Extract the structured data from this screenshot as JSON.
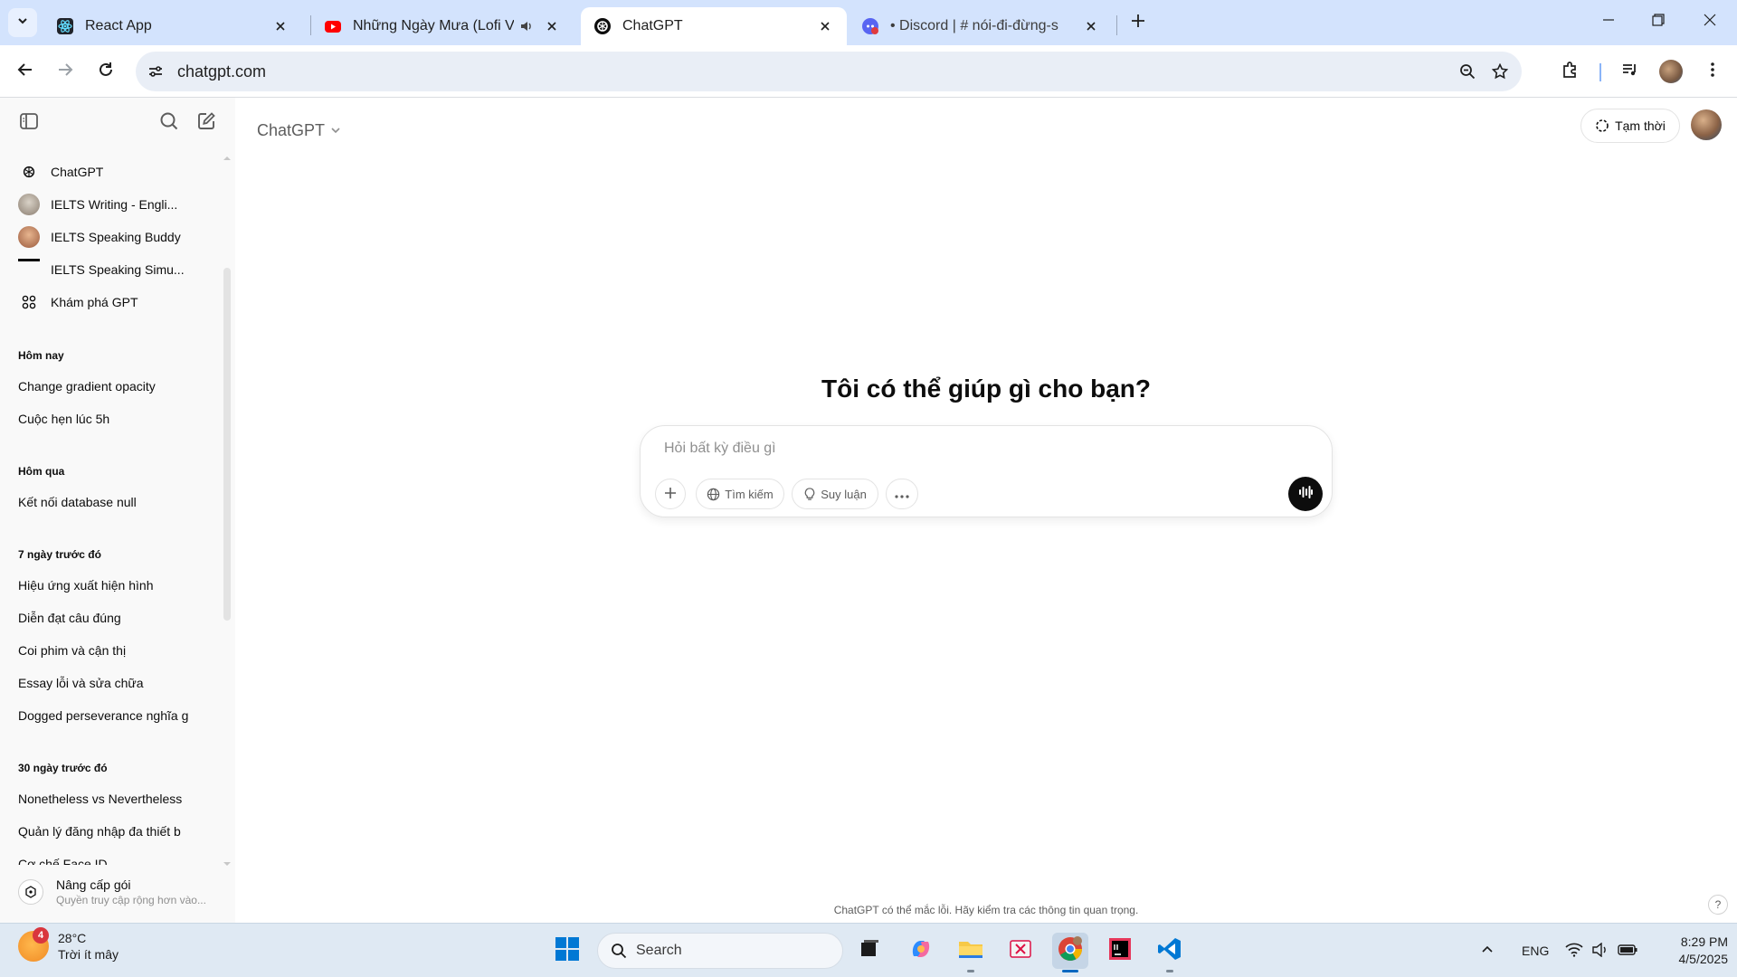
{
  "browser": {
    "tabs": [
      {
        "title": "React App",
        "icon": "react-icon",
        "active": false
      },
      {
        "title": "Những Ngày Mưa (Lofi Ver.)",
        "icon": "youtube-icon",
        "active": false,
        "audio": true
      },
      {
        "title": "ChatGPT",
        "icon": "openai-icon",
        "active": true
      },
      {
        "title": "• Discord | #​ nói-đi-đừng-s",
        "icon": "discord-icon",
        "active": false
      }
    ],
    "url": "chatgpt.com",
    "accent": "#d3e3fd"
  },
  "sidebar": {
    "gpts": [
      {
        "label": "ChatGPT",
        "icon": "openai-icon"
      },
      {
        "label": "IELTS Writing - Engli...",
        "icon": "gpt-avatar-icon"
      },
      {
        "label": "IELTS Speaking Buddy",
        "icon": "gpt-avatar-icon"
      },
      {
        "label": "IELTS Speaking Simu...",
        "icon": "gpt-avatar-icon"
      },
      {
        "label": "Khám phá GPT",
        "icon": "grid-icon"
      }
    ],
    "sections": [
      {
        "title": "Hôm nay",
        "chats": [
          "Change gradient opacity",
          "Cuộc hẹn lúc 5h"
        ]
      },
      {
        "title": "Hôm qua",
        "chats": [
          "Kết nối database null"
        ]
      },
      {
        "title": "7 ngày trước đó",
        "chats": [
          "Hiệu ứng xuất hiện hình",
          "Diễn đạt câu đúng",
          "Coi phim và cận thị",
          "Essay lỗi và sửa chữa",
          "Dogged perseverance nghĩa g"
        ]
      },
      {
        "title": "30 ngày trước đó",
        "chats": [
          "Nonetheless vs Nevertheless",
          "Quản lý đăng nhập đa thiết b",
          "Cơ chế Face ID"
        ]
      }
    ],
    "upgrade": {
      "title": "Nâng cấp gói",
      "subtitle": "Quyền truy cập rộng hơn vào..."
    }
  },
  "main": {
    "model": "ChatGPT",
    "temporary": "Tạm thời",
    "headline": "Tôi có thể giúp gì cho bạn?",
    "composer": {
      "placeholder": "Hỏi bất kỳ điều gì",
      "search": "Tìm kiếm",
      "reason": "Suy luận"
    },
    "disclaimer": "ChatGPT có thể mắc lỗi. Hãy kiểm tra các thông tin quan trọng.",
    "help": "?"
  },
  "taskbar": {
    "weather": {
      "temp": "28°C",
      "condition": "Trời ít mây",
      "badge": "4"
    },
    "search_label": "Search",
    "language": "ENG",
    "time": "8:29 PM",
    "date": "4/5/2025"
  }
}
